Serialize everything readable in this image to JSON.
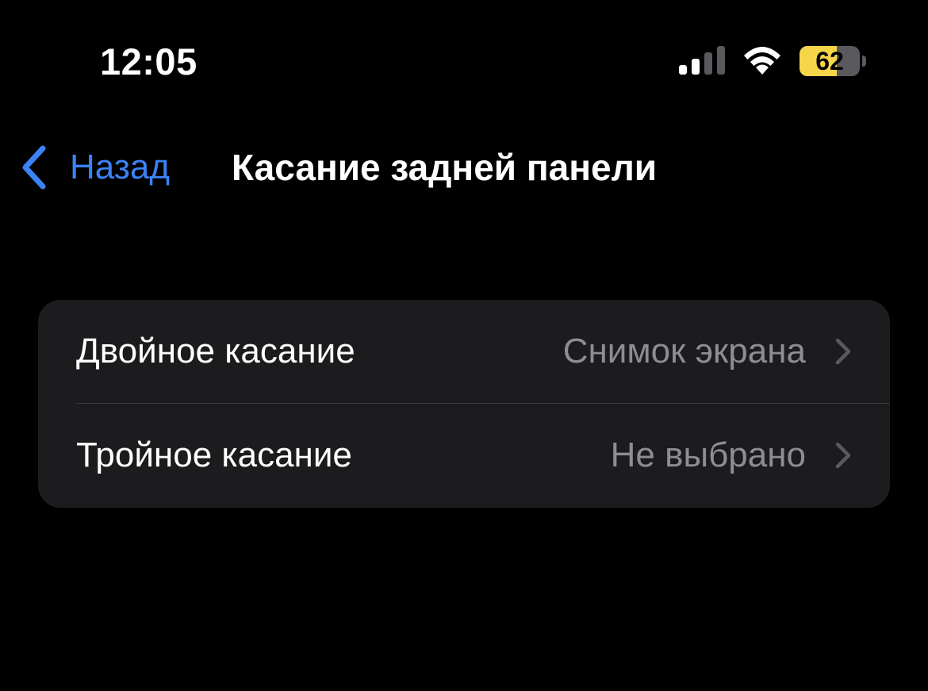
{
  "status_bar": {
    "time": "12:05",
    "battery_percent": "62",
    "battery_level": 0.62,
    "signal_bars_active": 2,
    "signal_bars_total": 4,
    "icons": [
      "signal-icon",
      "wifi-icon",
      "battery-icon"
    ]
  },
  "nav": {
    "back_label": "Назад",
    "title": "Касание задней панели"
  },
  "settings": {
    "rows": [
      {
        "label": "Двойное касание",
        "value": "Снимок экрана"
      },
      {
        "label": "Тройное касание",
        "value": "Не выбрано"
      }
    ]
  },
  "colors": {
    "background": "#000000",
    "group_background": "#1c1c1e",
    "accent": "#3b82f6",
    "secondary_text": "#8d8d93",
    "chevron": "#5a5a5e",
    "battery_fill": "#f7d54a"
  }
}
